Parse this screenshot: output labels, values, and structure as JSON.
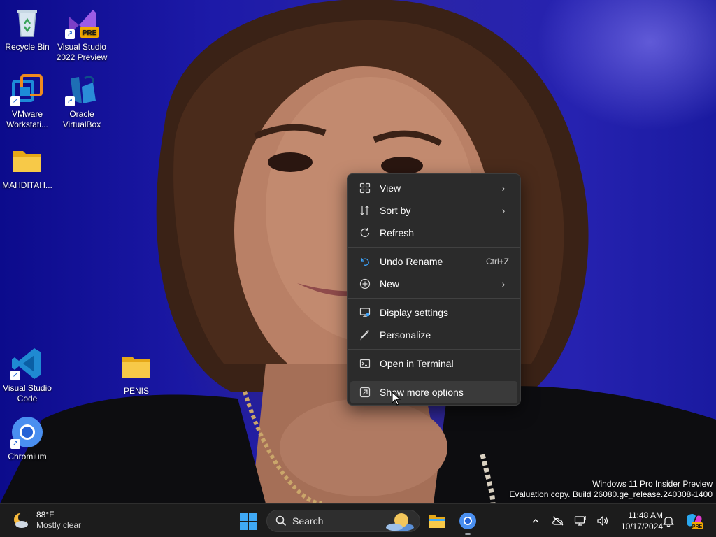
{
  "desktop": {
    "icons": [
      {
        "label": "Recycle Bin"
      },
      {
        "label": "Visual Studio 2022 Preview",
        "badge": "PRE"
      },
      {
        "label": "VMware Workstati..."
      },
      {
        "label": "Oracle VirtualBox"
      },
      {
        "label": "MAHDITAH..."
      },
      {
        "label": "Visual Studio Code"
      },
      {
        "label": "PENIS"
      },
      {
        "label": "Chromium"
      }
    ]
  },
  "context_menu": {
    "items": [
      {
        "label": "View",
        "icon": "grid-icon",
        "submenu": true
      },
      {
        "label": "Sort by",
        "icon": "sort-icon",
        "submenu": true
      },
      {
        "label": "Refresh",
        "icon": "refresh-icon"
      },
      {
        "label": "Undo Rename",
        "icon": "undo-icon",
        "accelerator": "Ctrl+Z"
      },
      {
        "label": "New",
        "icon": "plus-circle-icon",
        "submenu": true
      },
      {
        "label": "Display settings",
        "icon": "display-icon"
      },
      {
        "label": "Personalize",
        "icon": "brush-icon"
      },
      {
        "label": "Open in Terminal",
        "icon": "terminal-icon"
      },
      {
        "label": "Show more options",
        "icon": "more-options-icon",
        "hovered": true
      }
    ]
  },
  "watermark": {
    "line1": "Windows 11 Pro Insider Preview",
    "line2": "Evaluation copy. Build 26080.ge_release.240308-1400"
  },
  "taskbar": {
    "weather": {
      "temp": "88°F",
      "condition": "Mostly clear"
    },
    "search_label": "Search",
    "clock": {
      "time": "11:48 AM",
      "date": "10/17/2024"
    },
    "copilot_badge": "PRE"
  },
  "colors": {
    "menu_bg": "#2b2b2b",
    "taskbar_bg": "#1c1c1c",
    "accent": "#0078d4"
  }
}
